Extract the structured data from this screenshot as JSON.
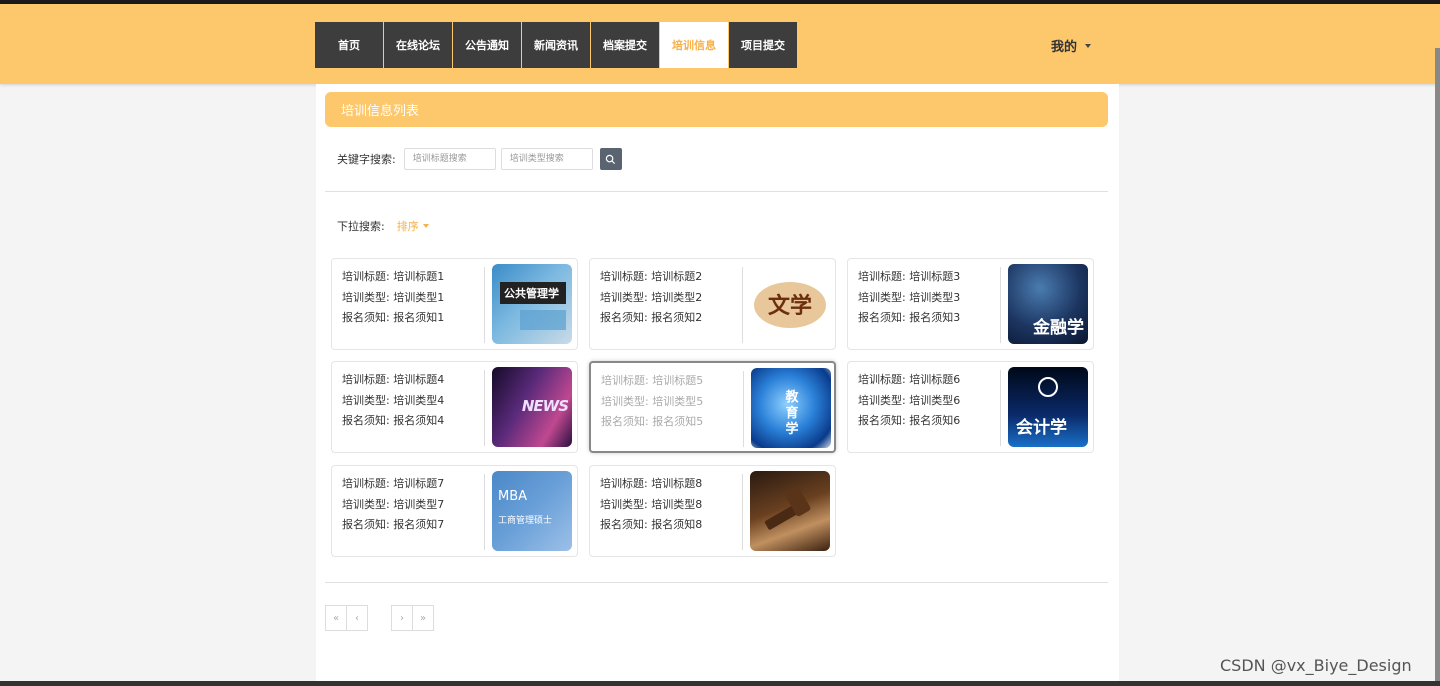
{
  "nav": {
    "items": [
      {
        "label": "首页",
        "active": false
      },
      {
        "label": "在线论坛",
        "active": false
      },
      {
        "label": "公告通知",
        "active": false
      },
      {
        "label": "新闻资讯",
        "active": false
      },
      {
        "label": "档案提交",
        "active": false
      },
      {
        "label": "培训信息",
        "active": true
      },
      {
        "label": "项目提交",
        "active": false
      }
    ],
    "user_menu": "我的"
  },
  "section_title": "培训信息列表",
  "search": {
    "label": "关键字搜索:",
    "title_placeholder": "培训标题搜索",
    "type_placeholder": "培训类型搜索"
  },
  "sort": {
    "label": "下拉搜索:",
    "button": "排序"
  },
  "cards": [
    {
      "title": "培训标题: 培训标题1",
      "type": "培训类型: 培训类型1",
      "notice": "报名须知: 报名须知1",
      "image_text": "公共管理学",
      "image_icon": "book-cover-icon"
    },
    {
      "title": "培训标题: 培训标题2",
      "type": "培训类型: 培训类型2",
      "notice": "报名须知: 报名须知2",
      "image_text": "文学",
      "image_icon": "literature-icon"
    },
    {
      "title": "培训标题: 培训标题3",
      "type": "培训类型: 培训类型3",
      "notice": "报名须知: 报名须知3",
      "image_text": "金融学",
      "image_icon": "finance-icon"
    },
    {
      "title": "培训标题: 培训标题4",
      "type": "培训类型: 培训类型4",
      "notice": "报名须知: 报名须知4",
      "image_text": "NEWS",
      "image_icon": "news-icon"
    },
    {
      "title": "培训标题: 培训标题5",
      "type": "培训类型: 培训类型5",
      "notice": "报名须知: 报名须知5",
      "image_text": "教育学",
      "image_icon": "globe-bulb-icon"
    },
    {
      "title": "培训标题: 培训标题6",
      "type": "培训类型: 培训类型6",
      "notice": "报名须知: 报名须知6",
      "image_text": "会计学",
      "image_icon": "accounting-icon"
    },
    {
      "title": "培训标题: 培训标题7",
      "type": "培训类型: 培训类型7",
      "notice": "报名须知: 报名须知7",
      "image_text": "MBA",
      "image_subtext": "工商管理硕士",
      "image_icon": "mba-icon"
    },
    {
      "title": "培训标题: 培训标题8",
      "type": "培训类型: 培训类型8",
      "notice": "报名须知: 报名须知8",
      "image_text": "",
      "image_icon": "gavel-icon"
    }
  ],
  "pager": {
    "first": "«",
    "prev": "‹",
    "next": "›",
    "last": "»"
  },
  "watermark": "CSDN @vx_Biye_Design",
  "colors": {
    "accent": "#fdc76b",
    "nav_bg": "#3d3d3d",
    "active_text": "#f7b04a"
  }
}
